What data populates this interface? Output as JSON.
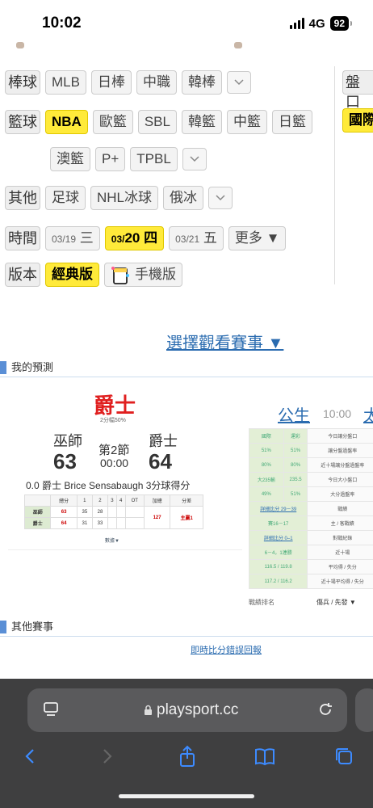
{
  "status": {
    "time": "10:02",
    "network": "4G",
    "battery": "92"
  },
  "rows": {
    "baseball": {
      "label": "棒球",
      "chips": [
        "MLB",
        "日棒",
        "中職",
        "韓棒"
      ]
    },
    "basketball": {
      "label": "籃球",
      "chips": [
        "NBA",
        "歐籃",
        "SBL",
        "韓籃",
        "中籃",
        "日籃"
      ],
      "active": "NBA"
    },
    "basketball2": {
      "chips": [
        "澳籃",
        "P+",
        "TPBL"
      ]
    },
    "other": {
      "label": "其他",
      "chips": [
        "足球",
        "NHL冰球",
        "俄冰"
      ]
    },
    "time": {
      "label": "時間",
      "d1_date": "03/19",
      "d1_day": "三",
      "d2_date": "03/",
      "d2_num": "20",
      "d2_day": "四",
      "d3_date": "03/21",
      "d3_day": "五",
      "more": "更多 ▼"
    },
    "version": {
      "label": "版本",
      "classic": "經典版",
      "mobile": "手機版"
    },
    "right": {
      "pan": "盤口",
      "intl": "國際"
    }
  },
  "select_link": "選擇觀看賽事 ▼",
  "sections": {
    "my_prediction": "我的預測",
    "other_games": "其他賽事"
  },
  "prediction": {
    "team": "爵士",
    "sub": "2分幅50%",
    "away_name": "巫師",
    "home_name": "爵士",
    "away_score": "63",
    "home_score": "64",
    "period": "第2節",
    "clock": "00:00",
    "play": "0.0 爵士 Brice Sensabaugh 3分球得分",
    "table": {
      "headers": [
        "",
        "總分",
        "1",
        "2",
        "3",
        "4",
        "OT",
        "加總",
        "分差"
      ],
      "rows": [
        [
          "巫師",
          "63",
          "35",
          "28",
          "",
          "",
          "",
          "127",
          "主贏1"
        ],
        [
          "爵士",
          "64",
          "31",
          "33",
          "",
          "",
          "",
          "",
          ""
        ]
      ]
    },
    "data_link": "數據▼"
  },
  "game2": {
    "team": "公生",
    "time": "10:00",
    "cut_team": "太",
    "header": [
      "國際",
      "運彩",
      "今日讓分盤口"
    ],
    "rows": [
      [
        "",
        "",
        "今日讓分盤口"
      ],
      [
        "51%",
        "51%",
        "讓分盤過盤率"
      ],
      [
        "80%",
        "80%",
        "近十場讓分盤過盤率"
      ],
      [
        "大235輸",
        "235.5",
        "今日大小盤口"
      ],
      [
        "49%",
        "51%",
        "大分過盤率"
      ],
      [
        "詳細比分 29－39",
        "",
        "戰績"
      ],
      [
        "賽16－17",
        "",
        "主 / 客戰績"
      ],
      [
        "詳細比分 0–1",
        "",
        "對戰紀錄"
      ],
      [
        "6－4，1連勝",
        "",
        "近十場"
      ],
      [
        "116.5 / 119.8",
        "",
        "平均得 / 失分"
      ],
      [
        "117.2 / 116.2",
        "",
        "近十場平均得 / 失分"
      ]
    ],
    "foot_left": "戰績排名",
    "foot_right": "傷兵 / 先發 ▼"
  },
  "report_link": "即時比分錯誤回報",
  "browser": {
    "url": "playsport.cc"
  }
}
